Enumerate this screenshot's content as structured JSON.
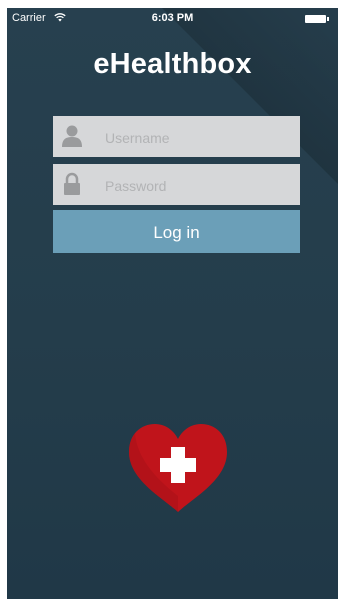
{
  "status_bar": {
    "carrier": "Carrier",
    "time": "6:03 PM"
  },
  "app": {
    "title": "eHealthbox"
  },
  "form": {
    "username_placeholder": "Username",
    "password_placeholder": "Password",
    "login_label": "Log in"
  },
  "colors": {
    "background": "#243d4b",
    "field": "#d6d7d9",
    "button": "#6b9fb8",
    "heart": "#c0141b"
  },
  "icons": [
    "wifi-icon",
    "battery-icon",
    "user-icon",
    "lock-icon",
    "heart-cross-icon"
  ]
}
